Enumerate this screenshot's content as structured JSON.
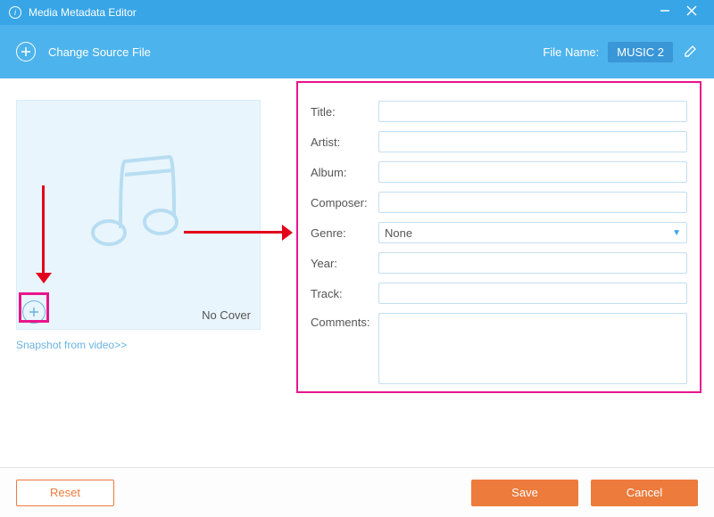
{
  "titlebar": {
    "title": "Media Metadata Editor"
  },
  "toolbar": {
    "change_source_label": "Change Source File",
    "filename_label": "File Name:",
    "filename_value": "MUSIC 2"
  },
  "cover": {
    "no_cover_text": "No Cover",
    "snapshot_link": "Snapshot from video>>"
  },
  "form": {
    "title_label": "Title:",
    "artist_label": "Artist:",
    "album_label": "Album:",
    "composer_label": "Composer:",
    "genre_label": "Genre:",
    "genre_value": "None",
    "year_label": "Year:",
    "track_label": "Track:",
    "comments_label": "Comments:",
    "title_value": "",
    "artist_value": "",
    "album_value": "",
    "composer_value": "",
    "year_value": "",
    "track_value": "",
    "comments_value": ""
  },
  "footer": {
    "reset_label": "Reset",
    "save_label": "Save",
    "cancel_label": "Cancel"
  }
}
